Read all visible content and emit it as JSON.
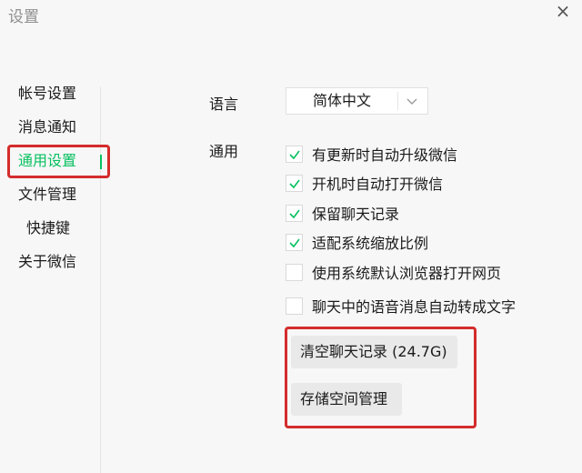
{
  "window": {
    "title": "设置",
    "close_symbol": "×"
  },
  "sidebar": {
    "items": [
      {
        "label": "帐号设置",
        "active": false
      },
      {
        "label": "消息通知",
        "active": false
      },
      {
        "label": "通用设置",
        "active": true
      },
      {
        "label": "文件管理",
        "active": false
      },
      {
        "label": "快捷键",
        "active": false
      },
      {
        "label": "关于微信",
        "active": false
      }
    ]
  },
  "general": {
    "language": {
      "label": "语言",
      "selected": "简体中文"
    },
    "section_label": "通用",
    "options": [
      {
        "label": "有更新时自动升级微信",
        "checked": true
      },
      {
        "label": "开机时自动打开微信",
        "checked": true
      },
      {
        "label": "保留聊天记录",
        "checked": true
      },
      {
        "label": "适配系统缩放比例",
        "checked": true
      },
      {
        "label": "使用系统默认浏览器打开网页",
        "checked": false
      },
      {
        "label": "聊天中的语音消息自动转成文字",
        "checked": false
      }
    ],
    "buttons": {
      "clear_history": "清空聊天记录 (24.7G)",
      "storage_management": "存储空间管理"
    }
  },
  "colors": {
    "accent": "#07c160",
    "highlight_box": "#d42c2c"
  },
  "icons": {
    "close": "close-icon",
    "dropdown": "chevron-down-icon",
    "check": "check-icon"
  }
}
